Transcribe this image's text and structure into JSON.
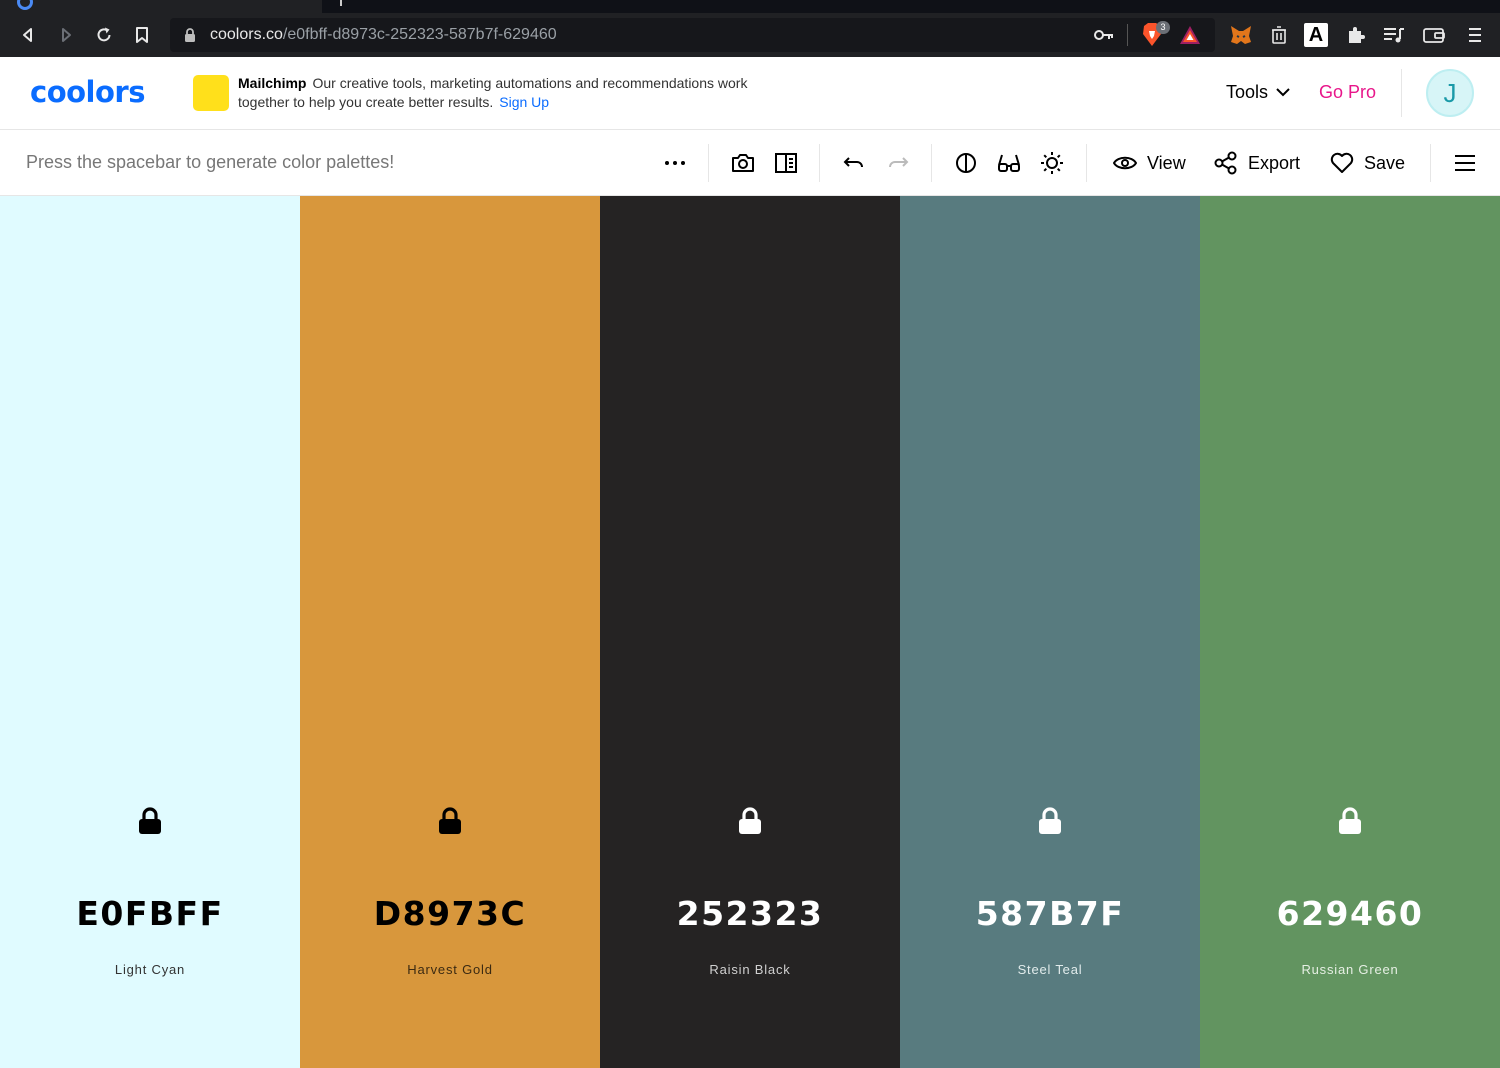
{
  "browser": {
    "url_host": "coolors.co",
    "url_path": "/e0fbff-d8973c-252323-587b7f-629460",
    "icons": [
      "back-icon",
      "forward-icon",
      "reload-icon",
      "bookmark-icon",
      "lock-icon",
      "key-icon",
      "brave-shields-icon",
      "brave-rewards-icon",
      "metamask-icon",
      "trash-extension-icon",
      "a-extension-icon",
      "extensions-puzzle-icon",
      "playlist-icon",
      "wallet-icon",
      "menu-icon"
    ],
    "shields_badge": "3"
  },
  "header": {
    "logo": "coolors",
    "ad": {
      "brand": "Mailchimp",
      "text": "Our creative tools, marketing automations and recommendations work together to help you create better results.",
      "link": "Sign Up",
      "swatch_color": "#ffe01b"
    },
    "tools_label": "Tools",
    "gopro_label": "Go Pro",
    "avatar_letter": "J"
  },
  "generator": {
    "hint": "Press the spacebar to generate color palettes!",
    "view_label": "View",
    "export_label": "Export",
    "save_label": "Save"
  },
  "palette": [
    {
      "hex": "E0FBFF",
      "name": "Light Cyan",
      "color": "#e0fbff",
      "text_color": "#000000",
      "name_color": "#333333"
    },
    {
      "hex": "D8973C",
      "name": "Harvest Gold",
      "color": "#d8973c",
      "text_color": "#000000",
      "name_color": "#3b2a12"
    },
    {
      "hex": "252323",
      "name": "Raisin Black",
      "color": "#252323",
      "text_color": "#ffffff",
      "name_color": "#d0d0d0"
    },
    {
      "hex": "587B7F",
      "name": "Steel Teal",
      "color": "#587b7f",
      "text_color": "#ffffff",
      "name_color": "#e2ecec"
    },
    {
      "hex": "629460",
      "name": "Russian Green",
      "color": "#629460",
      "text_color": "#ffffff",
      "name_color": "#e6efe4"
    }
  ]
}
